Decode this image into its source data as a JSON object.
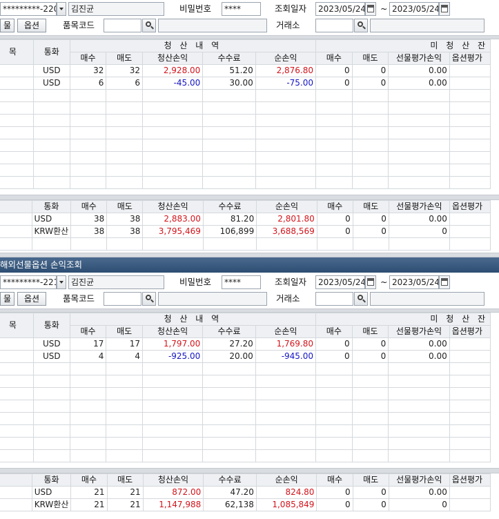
{
  "sections": [
    {
      "account": "*********-220",
      "name": "김진균",
      "password_label": "비밀번호",
      "password": "****",
      "date_label": "조회일자",
      "date_from": "2023/05/24",
      "date_sep": "~",
      "date_to": "2023/05/24",
      "btn_futures": "물",
      "btn_options": "옵션",
      "item_code_label": "품목코드",
      "exchange_label": "거래소",
      "header": {
        "c0": "목",
        "currency": "통화",
        "settled_group": "청 산 내 역",
        "open_group": "미 청 산 잔",
        "buy": "매수",
        "sell": "매도",
        "pl": "청산손익",
        "fee": "수수료",
        "net": "순손익",
        "obuy": "매수",
        "osell": "매도",
        "fut_eval": "선물평가손익",
        "opt_eval": "옵션평가"
      },
      "rows": [
        {
          "currency": "USD",
          "buy": "32",
          "sell": "32",
          "pl": "2,928.00",
          "pl_sign": "pos",
          "fee": "51.20",
          "net": "2,876.80",
          "net_sign": "pos",
          "obuy": "0",
          "osell": "0",
          "fut_eval": "0.00"
        },
        {
          "currency": "USD",
          "buy": "6",
          "sell": "6",
          "pl": "-45.00",
          "pl_sign": "neg",
          "fee": "30.00",
          "net": "-75.00",
          "net_sign": "neg",
          "obuy": "0",
          "osell": "0",
          "fut_eval": "0.00"
        }
      ],
      "summary_header": {
        "currency": "통화",
        "buy": "매수",
        "sell": "매도",
        "pl": "청산손익",
        "fee": "수수료",
        "net": "순손익",
        "obuy": "매수",
        "osell": "매도",
        "fut_eval": "선물평가손익",
        "opt_eval": "옵션평가"
      },
      "summary": [
        {
          "currency": "USD",
          "buy": "38",
          "sell": "38",
          "pl": "2,883.00",
          "fee": "81.20",
          "net": "2,801.80",
          "obuy": "0",
          "osell": "0",
          "fut_eval": "0.00"
        },
        {
          "currency": "KRW환산",
          "buy": "38",
          "sell": "38",
          "pl": "3,795,469",
          "fee": "106,899",
          "net": "3,688,569",
          "obuy": "0",
          "osell": "0",
          "fut_eval": "0"
        }
      ]
    },
    {
      "account": "*********-221",
      "name": "김진균",
      "password_label": "비밀번호",
      "password": "****",
      "date_label": "조회일자",
      "date_from": "2023/05/24",
      "date_sep": "~",
      "date_to": "2023/05/24",
      "btn_futures": "물",
      "btn_options": "옵션",
      "item_code_label": "품목코드",
      "exchange_label": "거래소",
      "header": {
        "c0": "목",
        "currency": "통화",
        "settled_group": "청 산 내 역",
        "open_group": "미 청 산 잔",
        "buy": "매수",
        "sell": "매도",
        "pl": "청산손익",
        "fee": "수수료",
        "net": "순손익",
        "obuy": "매수",
        "osell": "매도",
        "fut_eval": "선물평가손익",
        "opt_eval": "옵션평가"
      },
      "rows": [
        {
          "currency": "USD",
          "buy": "17",
          "sell": "17",
          "pl": "1,797.00",
          "pl_sign": "pos",
          "fee": "27.20",
          "net": "1,769.80",
          "net_sign": "pos",
          "obuy": "0",
          "osell": "0",
          "fut_eval": "0.00"
        },
        {
          "currency": "USD",
          "buy": "4",
          "sell": "4",
          "pl": "-925.00",
          "pl_sign": "neg",
          "fee": "20.00",
          "net": "-945.00",
          "net_sign": "neg",
          "obuy": "0",
          "osell": "0",
          "fut_eval": "0.00"
        }
      ],
      "summary_header": {
        "currency": "통화",
        "buy": "매수",
        "sell": "매도",
        "pl": "청산손익",
        "fee": "수수료",
        "net": "순손익",
        "obuy": "매수",
        "osell": "매도",
        "fut_eval": "선물평가손익",
        "opt_eval": "옵션평가"
      },
      "summary": [
        {
          "currency": "USD",
          "buy": "21",
          "sell": "21",
          "pl": "872.00",
          "fee": "47.20",
          "net": "824.80",
          "obuy": "0",
          "osell": "0",
          "fut_eval": "0.00"
        },
        {
          "currency": "KRW환산",
          "buy": "21",
          "sell": "21",
          "pl": "1,147,988",
          "fee": "62,138",
          "net": "1,085,849",
          "obuy": "0",
          "osell": "0",
          "fut_eval": "0"
        }
      ]
    }
  ],
  "window2_title": "해외선물옵션 손익조회"
}
